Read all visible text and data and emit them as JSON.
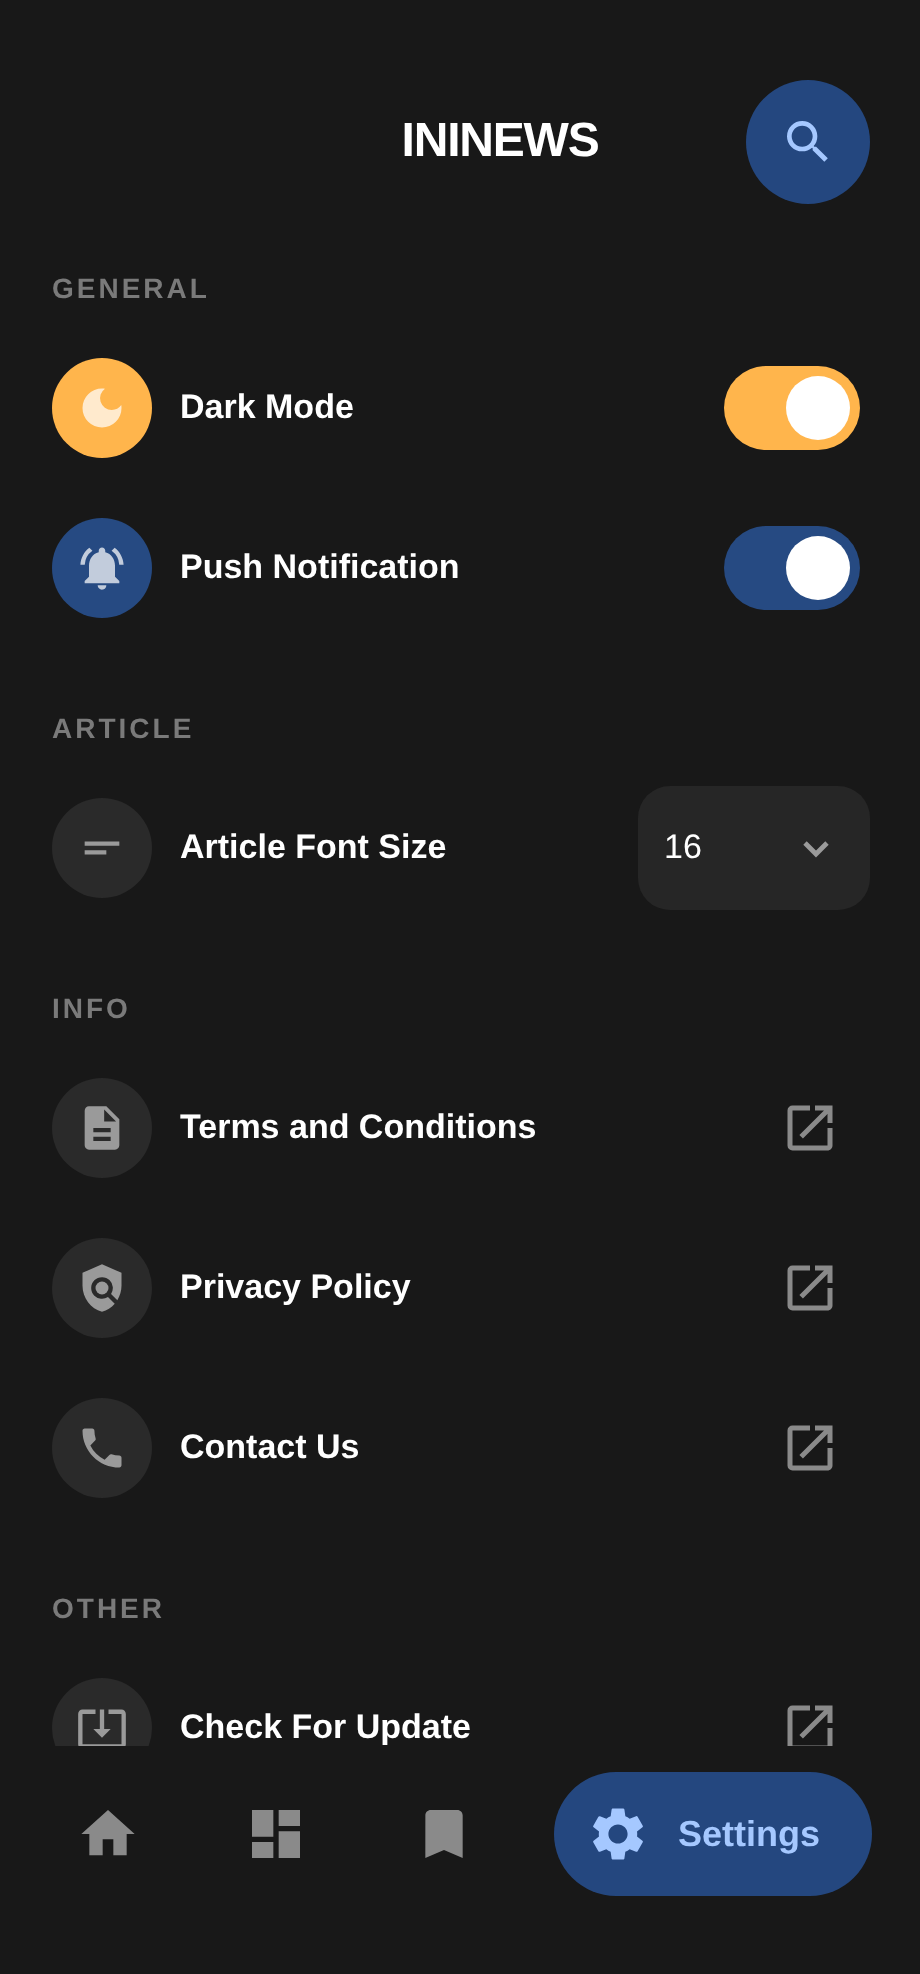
{
  "header": {
    "title": "ININEWS"
  },
  "sections": [
    {
      "title": "GENERAL",
      "items": [
        {
          "kind": "toggle",
          "label": "Dark Mode",
          "on": true,
          "color": "#ffb54c"
        },
        {
          "kind": "toggle",
          "label": "Push Notification",
          "on": true,
          "color": "#264a82"
        }
      ]
    },
    {
      "title": "ARTICLE",
      "items": [
        {
          "kind": "select",
          "label": "Article Font Size",
          "value": "16",
          "color": "#2a2a2a"
        }
      ]
    },
    {
      "title": "INFO",
      "items": [
        {
          "kind": "link",
          "label": "Terms and Conditions",
          "color": "#2a2a2a"
        },
        {
          "kind": "link",
          "label": "Privacy Policy",
          "color": "#2a2a2a"
        },
        {
          "kind": "link",
          "label": "Contact Us",
          "color": "#2a2a2a"
        }
      ]
    },
    {
      "title": "OTHER",
      "items": [
        {
          "kind": "link",
          "label": "Check For Update",
          "color": "#2a2a2a"
        }
      ]
    }
  ],
  "nav": [
    {
      "selected": false
    },
    {
      "selected": false
    },
    {
      "selected": false
    },
    {
      "label": "Settings",
      "selected": true
    }
  ]
}
